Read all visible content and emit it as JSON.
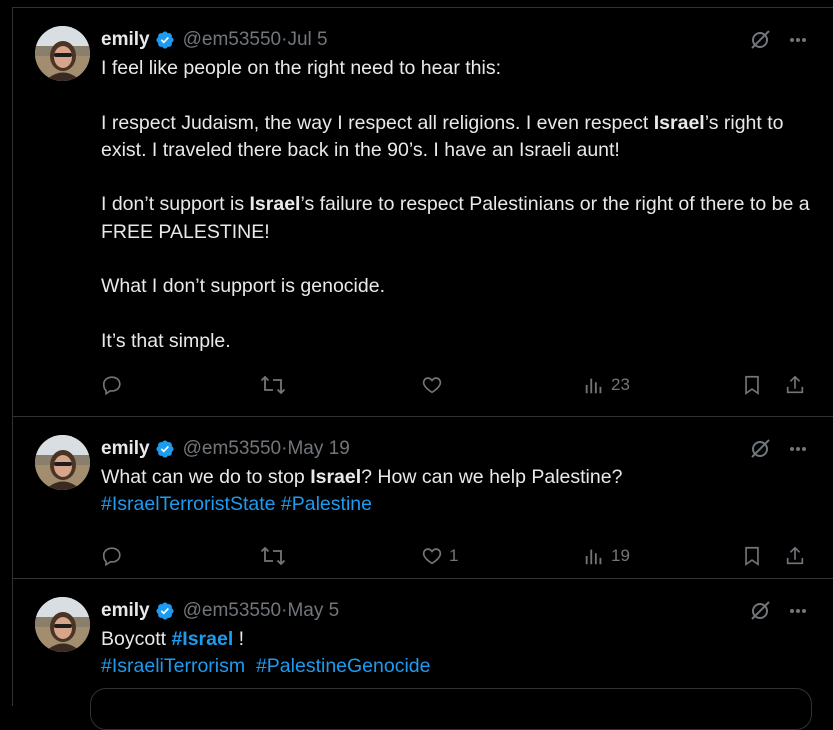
{
  "tweets": [
    {
      "name": "emily",
      "handle": "@em53550",
      "separator": "·",
      "date": "Jul 5",
      "paragraphs": [
        [
          "I feel like people on the right need to hear this:"
        ],
        [
          "I respect Judaism, the way I respect all religions. I even respect ",
          "Israel",
          "’s right to exist. I traveled there back in the 90’s. I have an Israeli aunt!"
        ],
        [
          "I don’t support is ",
          "Israel",
          "’s failure to respect Palestinians or the right of there to be a FREE PALESTINE!"
        ],
        [
          "What I don’t support is genocide."
        ],
        [
          "It’s that simple."
        ]
      ],
      "replies": "",
      "retweets": "",
      "likes": "",
      "views": "23"
    },
    {
      "name": "emily",
      "handle": "@em53550",
      "separator": "·",
      "date": "May 19",
      "line1_pre": "What can we do to stop ",
      "line1_bold": "Israel",
      "line1_post": "? How can we help Palestine?",
      "hashtags": [
        "#IsraelTerroristState",
        "#Palestine"
      ],
      "replies": "",
      "retweets": "",
      "likes": "1",
      "views": "19"
    },
    {
      "name": "emily",
      "handle": "@em53550",
      "separator": "·",
      "date": "May 5",
      "line1_pre": "Boycott ",
      "line1_hashtag": "#Israel",
      "line1_post": " !",
      "hashtags": [
        "#IsraeliTerrorism",
        "#PalestineGenocide"
      ]
    }
  ],
  "colors": {
    "background": "#000000",
    "text": "#e7e9ea",
    "muted": "#71767b",
    "link": "#1d9bf0",
    "verified": "#1d9bf0",
    "border": "#2f3336"
  },
  "icons": {
    "verified": "verified-badge-icon",
    "grok": "grok-icon",
    "more": "more-options-icon",
    "reply": "reply-icon",
    "retweet": "retweet-icon",
    "like": "heart-icon",
    "views": "views-icon",
    "bookmark": "bookmark-icon",
    "share": "share-icon"
  }
}
